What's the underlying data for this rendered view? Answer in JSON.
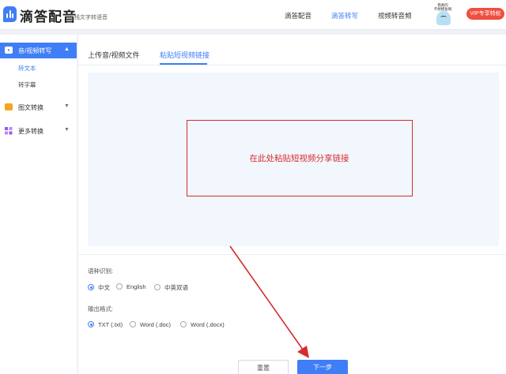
{
  "app": {
    "title": "滴答配音",
    "subtitle": "在线文字转语音"
  },
  "nav": {
    "items": [
      "滴答配音",
      "滴答转写",
      "视频转音频"
    ],
    "active_index": 1
  },
  "user": {
    "avatar_caption_1": "我真的",
    "avatar_caption_2": "不想摸鱼啊",
    "vip_label": "VIP专享特权"
  },
  "sidebar": {
    "groups": [
      {
        "label": "音/视频转写",
        "icon": "video-icon",
        "expanded": true,
        "active": true,
        "sub": [
          {
            "label": "转文本",
            "active": true
          },
          {
            "label": "转字幕",
            "active": false
          }
        ]
      },
      {
        "label": "图文转换",
        "icon": "image-icon",
        "expanded": false
      },
      {
        "label": "更多转换",
        "icon": "apps-icon",
        "expanded": false
      }
    ]
  },
  "tabs": {
    "items": [
      "上传音/视频文件",
      "粘贴短视频链接"
    ],
    "active_index": 1
  },
  "paste": {
    "hint": "在此处粘贴短视频分享链接"
  },
  "language": {
    "label": "语种识别:",
    "options": [
      "中文",
      "English",
      "中英双语"
    ],
    "selected_index": 0
  },
  "format": {
    "label": "输出格式:",
    "options": [
      "TXT (.txt)",
      "Word (.doc)",
      "Word (.docx)"
    ],
    "selected_index": 0
  },
  "buttons": {
    "reset": "重置",
    "next": "下一步"
  },
  "colors": {
    "accent": "#3f7ef6",
    "annotation": "#d62d2d",
    "vip": "#ef4f41"
  }
}
